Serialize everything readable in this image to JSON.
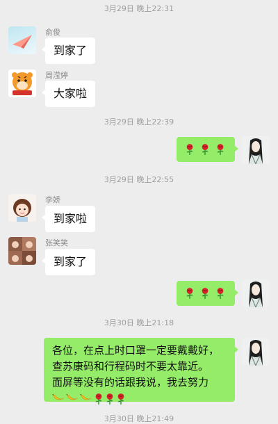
{
  "messages": {
    "ts0": "3月29日 晚上22:31",
    "m1": {
      "sender": "俞俊",
      "text": "到家了"
    },
    "m2": {
      "sender": "周滢婷",
      "text": "大家啦"
    },
    "ts1": "3月29日 晚上22:39",
    "m3": {
      "emoji": [
        "rose",
        "rose",
        "rose"
      ]
    },
    "ts2": "3月29日 晚上22:55",
    "m4": {
      "sender": "李娇",
      "text": "到家啦"
    },
    "m5": {
      "sender": "张笑笑",
      "text": "到家了"
    },
    "m6": {
      "emoji": [
        "rose",
        "rose",
        "rose"
      ]
    },
    "ts3": "3月30日 晚上21:18",
    "m7": {
      "lines": [
        "各位，在点上时口罩一定要戴戴好，",
        "查苏康码和行程码时不要太靠近。",
        "面屏等没有的话跟我说，我去努力"
      ],
      "emoji": [
        "banana",
        "banana",
        "banana",
        "rose",
        "rose",
        "rose"
      ]
    },
    "ts4": "3月30日 晚上21:49"
  },
  "colors": {
    "background": "#ededed",
    "outgoing": "#95ec69",
    "incoming": "#ffffff"
  }
}
